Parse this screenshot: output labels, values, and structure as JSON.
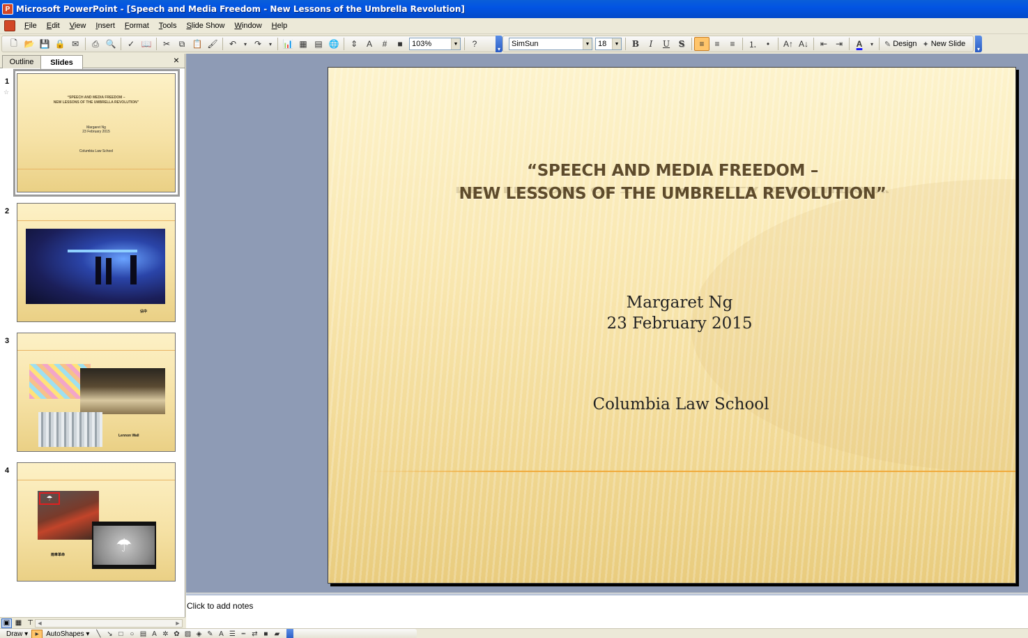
{
  "window": {
    "title": "Microsoft PowerPoint - [Speech and Media Freedom - New Lessons of the Umbrella Revolution]"
  },
  "menu": {
    "items": [
      "File",
      "Edit",
      "View",
      "Insert",
      "Format",
      "Tools",
      "Slide Show",
      "Window",
      "Help"
    ]
  },
  "toolbar": {
    "zoom": "103%",
    "font": "SimSun",
    "font_size": "18",
    "bold_label": "B",
    "italic_label": "I",
    "underline_label": "U",
    "shadow_label": "S",
    "design_label": "Design",
    "new_slide_label": "New Slide",
    "align_left_active": true
  },
  "panel": {
    "tab_outline": "Outline",
    "tab_slides": "Slides",
    "close": "×",
    "selected_slide": 1
  },
  "thumbnails": [
    {
      "number": "1",
      "title_lines": [
        "“SPEECH AND MEDIA FREEDOM –",
        "NEW LESSONS OF THE UMBRELLA REVOLUTION”"
      ],
      "author_lines": [
        "Margaret Ng",
        "23 February 2015"
      ],
      "school": "Columbia Law School"
    },
    {
      "number": "2",
      "caption": "佔中"
    },
    {
      "number": "3",
      "caption": "Lennon Wall"
    },
    {
      "number": "4",
      "caption": "雨傘革命"
    }
  ],
  "slide": {
    "title_lines": [
      "“SPEECH AND MEDIA FREEDOM –",
      "NEW LESSONS OF THE UMBRELLA REVOLUTION”"
    ],
    "author_lines": [
      "Margaret Ng",
      "23 February 2015"
    ],
    "school": "Columbia Law School"
  },
  "notes": {
    "placeholder": "Click to add notes"
  },
  "drawbar": {
    "draw_label": "Draw ▾",
    "autoshapes_label": "AutoShapes ▾"
  },
  "colors": {
    "titlebar": "#0254e3",
    "workspace": "#8e9bb5",
    "slide_title": "#5e4b2b",
    "accent_line": "#f0aa3c"
  }
}
